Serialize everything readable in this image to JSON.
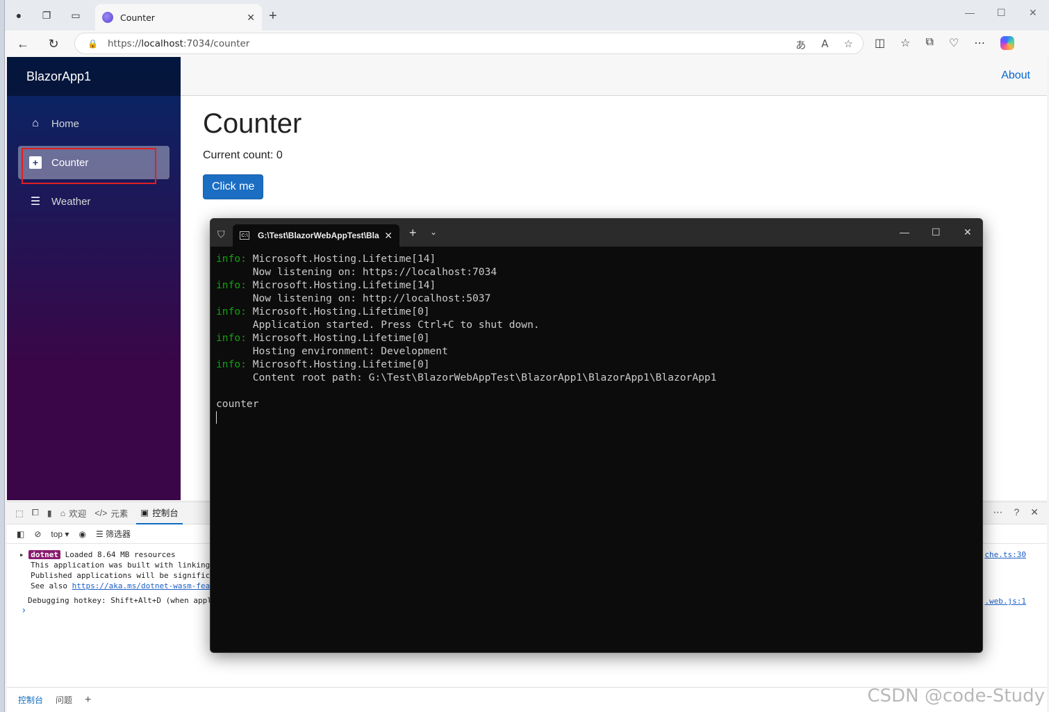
{
  "browser": {
    "tab_title": "Counter",
    "url_prefix": "https://",
    "url_host": "localhost",
    "url_rest": ":7034/counter",
    "icons": [
      "profile-icon",
      "workspaces-icon",
      "tab-actions-icon",
      "back-icon",
      "refresh-icon",
      "lock-icon",
      "translate-icon",
      "read-aloud-icon",
      "favorite-star-icon",
      "split-screen-icon",
      "favorites-icon",
      "collections-icon",
      "performance-icon",
      "more-icon",
      "copilot-icon"
    ]
  },
  "app": {
    "brand": "BlazorApp1",
    "about": "About",
    "nav": [
      {
        "label": "Home",
        "icon": "home-icon"
      },
      {
        "label": "Counter",
        "icon": "plus-icon"
      },
      {
        "label": "Weather",
        "icon": "list-icon"
      }
    ],
    "heading": "Counter",
    "count_text": "Current count: 0",
    "button": "Click me"
  },
  "devtools": {
    "tabs": [
      "欢迎",
      "元素",
      "控制台"
    ],
    "toolbar": {
      "context": "top",
      "filter": "筛选器"
    },
    "console": {
      "badge": "dotnet",
      "line1": "Loaded 8.64 MB resources",
      "line2": "This application was built with linking",
      "line3": "Published applications will be significa",
      "line4_prefix": "See also ",
      "line4_link": "https://aka.ms/dotnet-wasm-feat",
      "line5": "Debugging hotkey: Shift+Alt+D (when appl",
      "src1": "che.ts:30",
      "src2": ".web.js:1"
    },
    "bottom_tabs": [
      "控制台",
      "问题"
    ]
  },
  "terminal": {
    "tab_title": "G:\\Test\\BlazorWebAppTest\\Bla",
    "lines": [
      {
        "prefix": "info:",
        "text": " Microsoft.Hosting.Lifetime[14]"
      },
      {
        "prefix": "",
        "text": "      Now listening on: https://localhost:7034"
      },
      {
        "prefix": "info:",
        "text": " Microsoft.Hosting.Lifetime[14]"
      },
      {
        "prefix": "",
        "text": "      Now listening on: http://localhost:5037"
      },
      {
        "prefix": "info:",
        "text": " Microsoft.Hosting.Lifetime[0]"
      },
      {
        "prefix": "",
        "text": "      Application started. Press Ctrl+C to shut down."
      },
      {
        "prefix": "info:",
        "text": " Microsoft.Hosting.Lifetime[0]"
      },
      {
        "prefix": "",
        "text": "      Hosting environment: Development"
      },
      {
        "prefix": "info:",
        "text": " Microsoft.Hosting.Lifetime[0]"
      },
      {
        "prefix": "",
        "text": "      Content root path: G:\\Test\\BlazorWebAppTest\\BlazorApp1\\BlazorApp1\\BlazorApp1"
      },
      {
        "prefix": "",
        "text": ""
      },
      {
        "prefix": "",
        "text": "counter"
      }
    ]
  },
  "watermark": "CSDN @code-Study"
}
